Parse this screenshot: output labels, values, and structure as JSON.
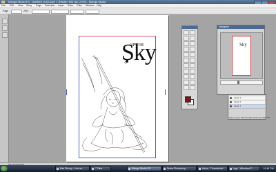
{
  "window": {
    "title": "Manga Studio EX - [untitled_A4] Layer 1 (Raster, 600 dpi, 2.0%) - Manga Studio"
  },
  "menu": [
    "File",
    "Edit",
    "View",
    "Story",
    "Page",
    "Selection",
    "Layer",
    "Ruler",
    "Filter",
    "Window",
    "Help"
  ],
  "options_bar": {
    "page_label": "Page",
    "zoom_label": "25%",
    "fields": [
      "",
      "",
      "",
      ""
    ]
  },
  "artwork": {
    "logo_main": "Sky",
    "logo_small": "OF THE"
  },
  "navigator": {
    "title": "Navigator",
    "thumb_logo": "Sky"
  },
  "layers": {
    "rows": [
      {
        "name": "Layer 3"
      },
      {
        "name": "Layer 2"
      },
      {
        "name": "Layer 1"
      }
    ],
    "status": "Paper Layer 600 dpi (Monochrome) 50% 0%"
  },
  "colors": {
    "foreground": "#8a1010",
    "background": "#ffffff",
    "margin_guide": "#4060c8"
  },
  "status_bar": {
    "text": "Manga Studio EX"
  },
  "taskbar": {
    "items": [
      {
        "label": "Bad Strong - Live as..."
      },
      {
        "label": "7 Tabs"
      },
      {
        "label": "Manga Studio EX"
      },
      {
        "label": "Zebra Photoshop..."
      },
      {
        "label": "Inbox - Thunderbird"
      },
      {
        "label": "logo - Windows P..."
      }
    ],
    "clock": "10:46 PM"
  }
}
